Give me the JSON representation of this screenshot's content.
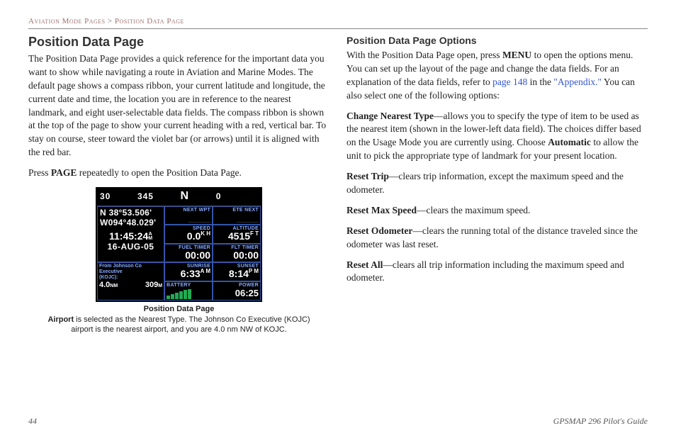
{
  "breadcrumb": {
    "section": "Aviation Mode Pages",
    "sep": ">",
    "page": "Position Data Page"
  },
  "col1": {
    "h1": "Position Data Page",
    "p1": "The Position Data Page provides a quick reference for the important data you want to show while navigating a route in Aviation and Marine Modes. The default page shows a compass ribbon, your current latitude and longitude, the current date and time, the location you are in reference to the nearest landmark, and eight user-selectable data fields. The compass ribbon is shown at the top of the page to show your current heading with a red, vertical bar. To stay on course, steer toward the violet bar (or arrows) until it is aligned with the red bar.",
    "p2a": "Press ",
    "p2b": "PAGE",
    "p2c": " repeatedly to open the Position Data Page.",
    "caption_title": "Position Data Page",
    "caption_b": "Airport",
    "caption_rest": " is selected as the Nearest Type. The Johnson Co Executive (KOJC) airport is the nearest airport, and you are 4.0 nm NW of KOJC."
  },
  "device": {
    "ribbon": {
      "l1": "30",
      "l2": "345",
      "c": "N",
      "r1": "0",
      "r2": ""
    },
    "lat": "N  38°53.506'",
    "lon": "W094°48.029'",
    "time": "11:45:24",
    "time_ampm_top": "A",
    "time_ampm_bot": "M",
    "date": "16-AUG-05",
    "from1": "From Johnson Co Executive",
    "from2": "(KOJC):",
    "dist": "4.0",
    "dist_u": "NM",
    "brg": "309",
    "brg_u": "M",
    "cells": {
      "nextwpt": {
        "label": "NEXT WPT",
        "val": "____"
      },
      "etenext": {
        "label": "ETE NEXT",
        "val": "____"
      },
      "speed": {
        "label": "SPEED",
        "val": "0.0",
        "unit": "K\nH"
      },
      "altitude": {
        "label": "ALTITUDE",
        "val": "4515",
        "unit": "F\nT"
      },
      "fueltmr": {
        "label": "FUEL TIMER",
        "val": "00:00"
      },
      "flttmr": {
        "label": "FLT TIMER",
        "val": "00:00"
      },
      "sunrise": {
        "label": "SUNRISE",
        "val": "6:33",
        "ampm": "A\nM"
      },
      "sunset": {
        "label": "SUNSET",
        "val": "8:14",
        "ampm": "P\nM"
      },
      "battery": {
        "label": "BATTERY"
      },
      "power": {
        "label": "POWER",
        "val": "06:25"
      }
    }
  },
  "col2": {
    "h2": "Position Data Page Options",
    "p1a": "With the Position Data Page open, press ",
    "p1b": "MENU",
    "p1c": " to open the options menu. You can set up the layout of the page and change the data fields. For an explanation of the data fields, refer to ",
    "p1_link1": "page 148",
    "p1d": " in the ",
    "p1_link2": "\"Appendix.\"",
    "p1e": " You can also select one of the following options:",
    "opt1b": "Change Nearest Type",
    "opt1": "—allows you to specify the type of item to be used as the nearest item (shown in the lower-left data field). The choices differ based on the Usage Mode you are currently using. Choose ",
    "opt1b2": "Automatic",
    "opt1c": " to allow the unit to pick the appropriate type of landmark for your present location.",
    "opt2b": "Reset Trip",
    "opt2": "—clears trip information, except the maximum speed and the odometer.",
    "opt3b": "Reset Max Speed",
    "opt3": "—clears the maximum speed.",
    "opt4b": "Reset Odometer",
    "opt4": "—clears the running total of the distance traveled since the odometer was last reset.",
    "opt5b": "Reset All",
    "opt5": "—clears all trip information including the maximum speed and odometer."
  },
  "footer": {
    "pagenum": "44",
    "title": "GPSMAP 296 Pilot's Guide"
  }
}
